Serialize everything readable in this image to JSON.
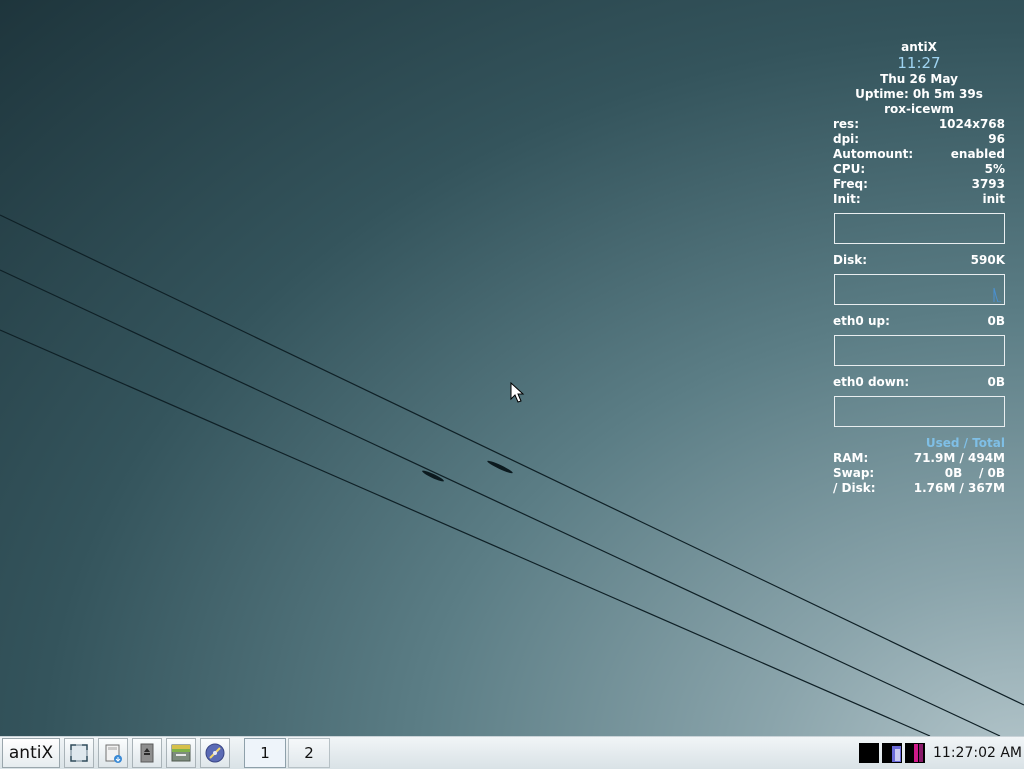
{
  "conky": {
    "hostname": "antiX",
    "time": "11:27",
    "date": "Thu 26 May",
    "uptime": "Uptime: 0h 5m 39s",
    "session": "rox-icewm",
    "stats": [
      {
        "label": "res:",
        "value": "1024x768"
      },
      {
        "label": "dpi:",
        "value": "96"
      },
      {
        "label": "Automount:",
        "value": "enabled"
      },
      {
        "label": "CPU:",
        "value": "5%"
      },
      {
        "label": "Freq:",
        "value": "3793"
      },
      {
        "label": "Init:",
        "value": "init"
      }
    ],
    "disk": {
      "label": "Disk:",
      "value": "590K"
    },
    "eth_up": {
      "label": "eth0 up:",
      "value": "0B"
    },
    "eth_down": {
      "label": "eth0 down:",
      "value": "0B"
    },
    "legend": "Used / Total",
    "memory": [
      {
        "label": "RAM:",
        "value": "71.9M / 494M"
      },
      {
        "label": "Swap:",
        "value": "0B    / 0B"
      },
      {
        "label": "/ Disk:",
        "value": "1.76M / 367M"
      }
    ],
    "legend_color": "#7fbfe6",
    "time_color": "#9fd3f0"
  },
  "taskbar": {
    "start_label": "antiX",
    "quick_launch": [
      {
        "name": "show-desktop-icon"
      },
      {
        "name": "file-manager-icon"
      },
      {
        "name": "terminal-icon"
      },
      {
        "name": "control-centre-icon"
      },
      {
        "name": "web-browser-icon"
      }
    ],
    "workspaces": [
      "1",
      "2"
    ],
    "active_workspace": "1",
    "clock": "11:27:02 AM"
  }
}
